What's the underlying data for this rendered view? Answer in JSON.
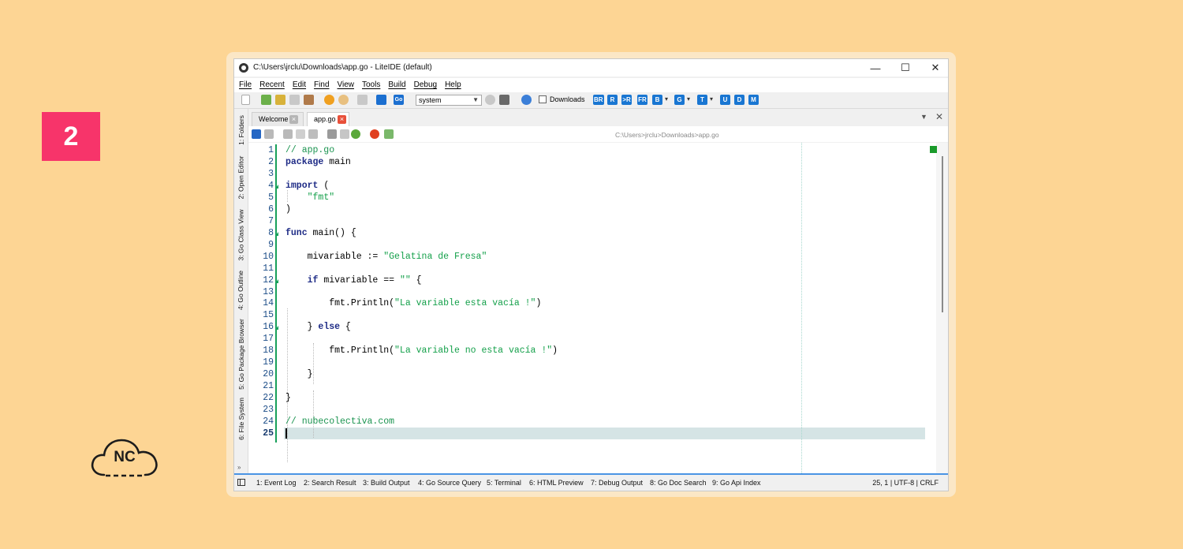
{
  "badge": "2",
  "logo": {
    "text": "NC"
  },
  "window": {
    "title": "C:\\Users\\jrclu\\Downloads\\app.go - LiteIDE (default)",
    "controls": {
      "minimize": "—",
      "maximize": "☐",
      "close": "✕"
    }
  },
  "menu": [
    "File",
    "Recent",
    "Edit",
    "Find",
    "View",
    "Tools",
    "Build",
    "Debug",
    "Help"
  ],
  "toolbar": {
    "go_label": "Go",
    "env_select": "system",
    "downloads_label": "Downloads",
    "build_buttons": [
      "BR",
      "R",
      ">R",
      "FR",
      "B",
      "G",
      "T",
      "U",
      "D",
      "M"
    ]
  },
  "dock_tabs": [
    "1: Folders",
    "2: Open Editor",
    "3: Go Class View",
    "4: Go Outline",
    "5: Go Package Browser",
    "6: File System"
  ],
  "editor_tabs": [
    {
      "label": "Welcome",
      "active": false
    },
    {
      "label": "app.go",
      "active": true
    }
  ],
  "file_path": "C:\\Users>jrclu>Downloads>app.go",
  "code_lines": [
    "// app.go",
    "package main",
    "",
    "import (",
    "    \"fmt\"",
    ")",
    "",
    "func main() {",
    "",
    "    mivariable := \"Gelatina de Fresa\"",
    "",
    "    if mivariable == \"\" {",
    "",
    "        fmt.Println(\"La variable esta vacía !\")",
    "",
    "    } else {",
    "",
    "        fmt.Println(\"La variable no esta vacía !\")",
    "",
    "    }",
    "",
    "}",
    "",
    "// nubecolectiva.com",
    ""
  ],
  "bottom_tabs": [
    "1: Event Log",
    "2: Search Result",
    "3: Build Output",
    "4: Go Source Query",
    "5: Terminal",
    "6: HTML Preview",
    "7: Debug Output",
    "8: Go Doc Search",
    "9: Go Api Index"
  ],
  "status": "25,  1 | UTF-8 | CRLF",
  "colors": {
    "background": "#fdd594",
    "badge": "#f7346a",
    "keyword": "#1e2b86",
    "string": "#14a04a",
    "line_number": "#1c4d88",
    "fold_marker": "#18a05a"
  }
}
